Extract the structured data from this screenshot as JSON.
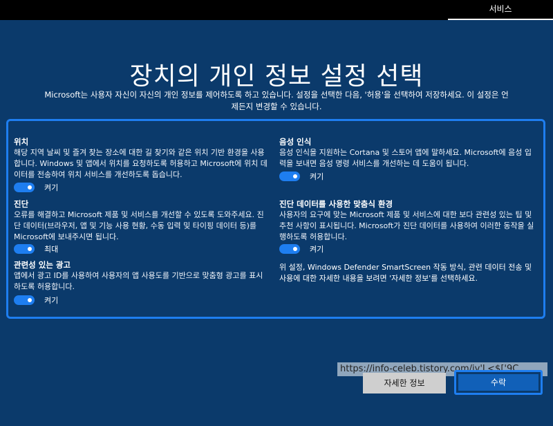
{
  "top_tab": "서비스",
  "title": "장치의 개인 정보 설정 선택",
  "subtitle": "Microsoft는 사용자 자신이 자신의 개인 정보를 제어하도록 하고 있습니다. 설정을 선택한 다음, '허용'을 선택하여 저장하세요. 이 설정은 언제든지 변경할 수 있습니다.",
  "left": [
    {
      "title": "위치",
      "desc": "해당 지역 날씨 및 즐겨 찾는 장소에 대한 길 찾기와 같은 위치 기반 환경을 사용합니다. Windows 및 앱에서 위치를 요청하도록 허용하고 Microsoft에 위치 데이터를 전송하여 위치 서비스를 개선하도록 돕습니다.",
      "toggle": "켜기"
    },
    {
      "title": "진단",
      "desc": "오류를 해결하고 Microsoft 제품 및 서비스를 개선할 수 있도록 도와주세요. 진단 데이터(브라우저, 앱 및 기능 사용 현황, 수동 입력 및 타이핑 데이터 등)를 Microsoft에 보내주시면 됩니다.",
      "toggle": "최대"
    },
    {
      "title": "관련성 있는 광고",
      "desc": "앱에서 광고 ID를 사용하여 사용자의 앱 사용도를 기반으로 맞춤형 광고를 표시하도록 허용합니다.",
      "toggle": "켜기"
    }
  ],
  "right": [
    {
      "title": "음성 인식",
      "desc": "음성 인식을 지원하는 Cortana 및 스토어 앱에 말하세요. Microsoft에 음성 입력을 보내면 음성 명령 서비스를 개선하는 데 도움이 됩니다.",
      "toggle": "켜기"
    },
    {
      "title": "진단 데이터를 사용한 맞춤식 환경",
      "desc": "사용자의 요구에 맞는 Microsoft 제품 및 서비스에 대한 보다 관련성 있는 팁 및 추천 사항이 표시됩니다. Microsoft가 진단 데이터를 사용하여 이러한 동작을 실행하도록 허용합니다.",
      "toggle": "켜기"
    }
  ],
  "note": "위 설정, Windows Defender SmartScreen 작동 방식, 관련 데이터 전송 및 사용에 대한 자세한 내용을 보려면 '자세한 정보'를 선택하세요.",
  "watermark": "https://info-celeb.tistory.com/jv'L<$['9C",
  "buttons": {
    "learn_more": "자세한 정보",
    "accept": "수락"
  }
}
